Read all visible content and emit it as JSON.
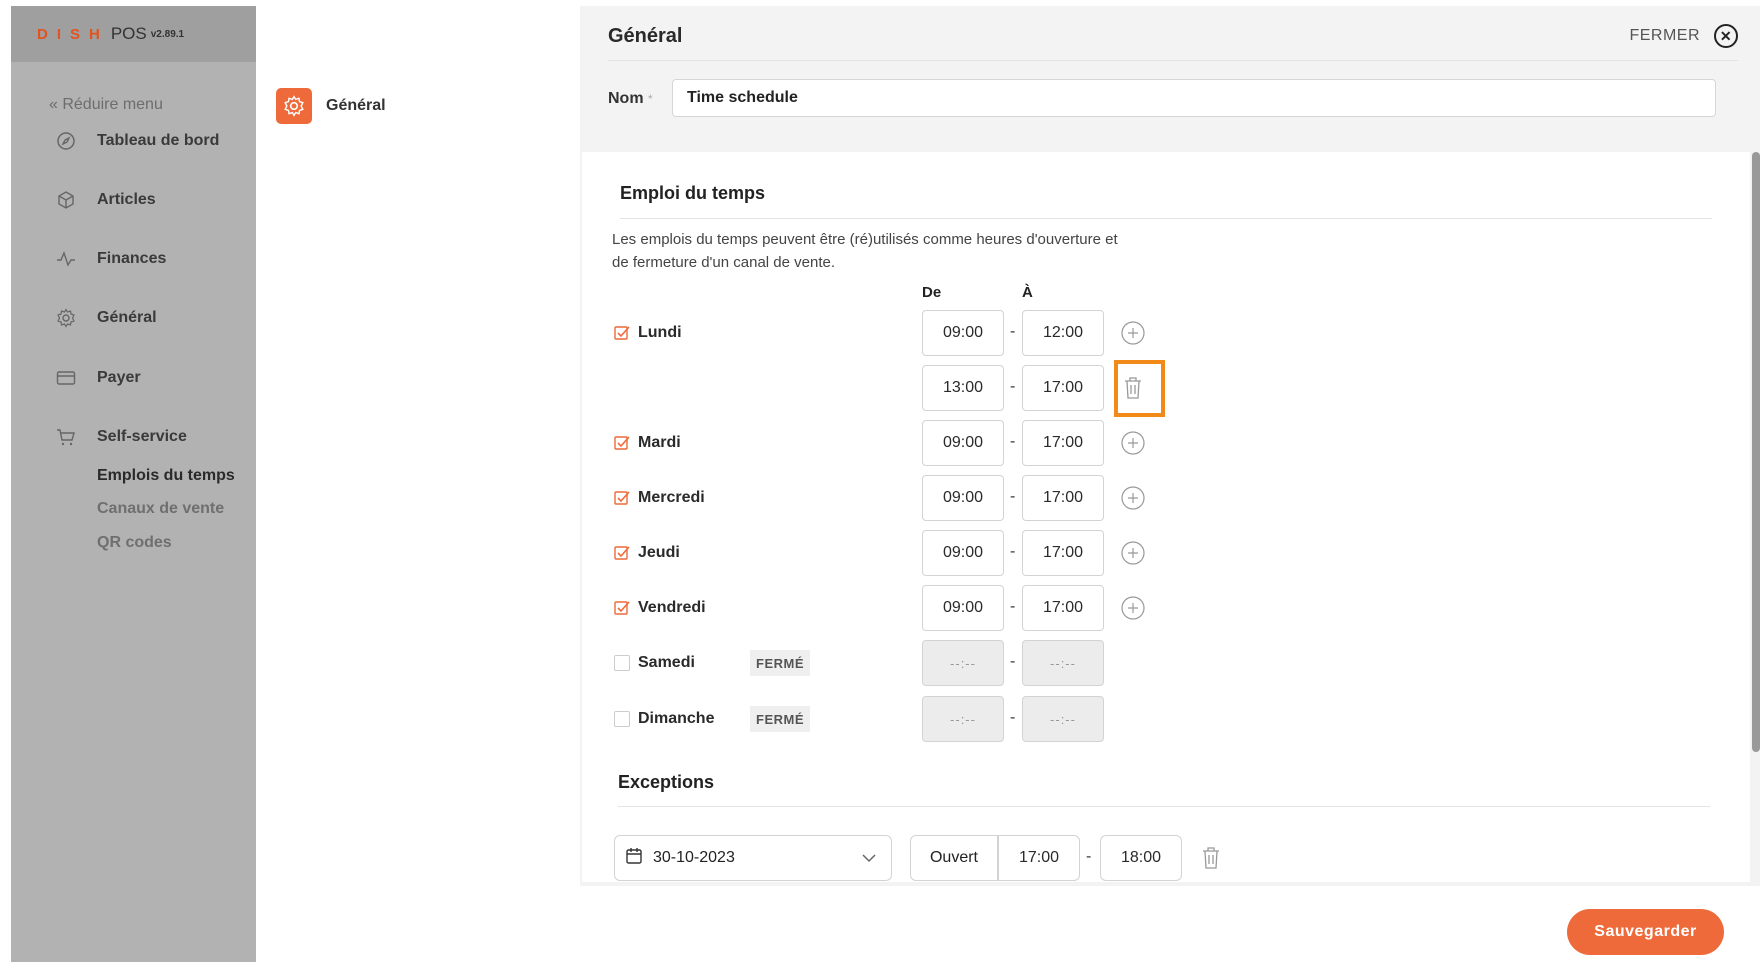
{
  "brand": {
    "dish": "DISH",
    "pos": "POS",
    "version": "v2.89.1"
  },
  "sidebar": {
    "collapse_label": "« Réduire menu",
    "items": [
      {
        "label": "Tableau de bord",
        "icon": "compass-icon"
      },
      {
        "label": "Articles",
        "icon": "box-icon"
      },
      {
        "label": "Finances",
        "icon": "activity-icon"
      },
      {
        "label": "Général",
        "icon": "gear-icon"
      },
      {
        "label": "Payer",
        "icon": "card-icon"
      },
      {
        "label": "Self-service",
        "icon": "cart-icon"
      }
    ],
    "subitems": [
      {
        "label": "Emplois du temps",
        "active": true
      },
      {
        "label": "Canaux de vente",
        "active": false
      },
      {
        "label": "QR codes",
        "active": false
      }
    ]
  },
  "subnav": {
    "label": "Général"
  },
  "panel": {
    "title": "Général",
    "close_label": "FERMER",
    "name_label": "Nom",
    "name_required": "*",
    "name_value": "Time schedule"
  },
  "schedule": {
    "title": "Emploi du temps",
    "description": "Les emplois du temps peuvent être (ré)utilisés comme heures d'ouverture et de fermeture d'un canal de vente.",
    "col_from": "De",
    "col_to": "À",
    "closed_label": "FERMÉ",
    "empty_time": "--:--",
    "rows": [
      {
        "day": "Lundi",
        "checked": true,
        "from": "09:00",
        "to": "12:00",
        "action": "plus"
      },
      {
        "day": "",
        "checked": null,
        "from": "13:00",
        "to": "17:00",
        "action": "trash"
      },
      {
        "day": "Mardi",
        "checked": true,
        "from": "09:00",
        "to": "17:00",
        "action": "plus"
      },
      {
        "day": "Mercredi",
        "checked": true,
        "from": "09:00",
        "to": "17:00",
        "action": "plus"
      },
      {
        "day": "Jeudi",
        "checked": true,
        "from": "09:00",
        "to": "17:00",
        "action": "plus"
      },
      {
        "day": "Vendredi",
        "checked": true,
        "from": "09:00",
        "to": "17:00",
        "action": "plus"
      },
      {
        "day": "Samedi",
        "checked": false,
        "from": "--:--",
        "to": "--:--",
        "action": "none"
      },
      {
        "day": "Dimanche",
        "checked": false,
        "from": "--:--",
        "to": "--:--",
        "action": "none"
      }
    ]
  },
  "exceptions": {
    "title": "Exceptions",
    "date": "30-10-2023",
    "status": "Ouvert",
    "from": "17:00",
    "to": "18:00"
  },
  "footer": {
    "save_label": "Sauvegarder"
  },
  "colors": {
    "accent": "#ee6a3a",
    "highlight": "#f28a1a",
    "sidebar": "#b2b2b2"
  }
}
